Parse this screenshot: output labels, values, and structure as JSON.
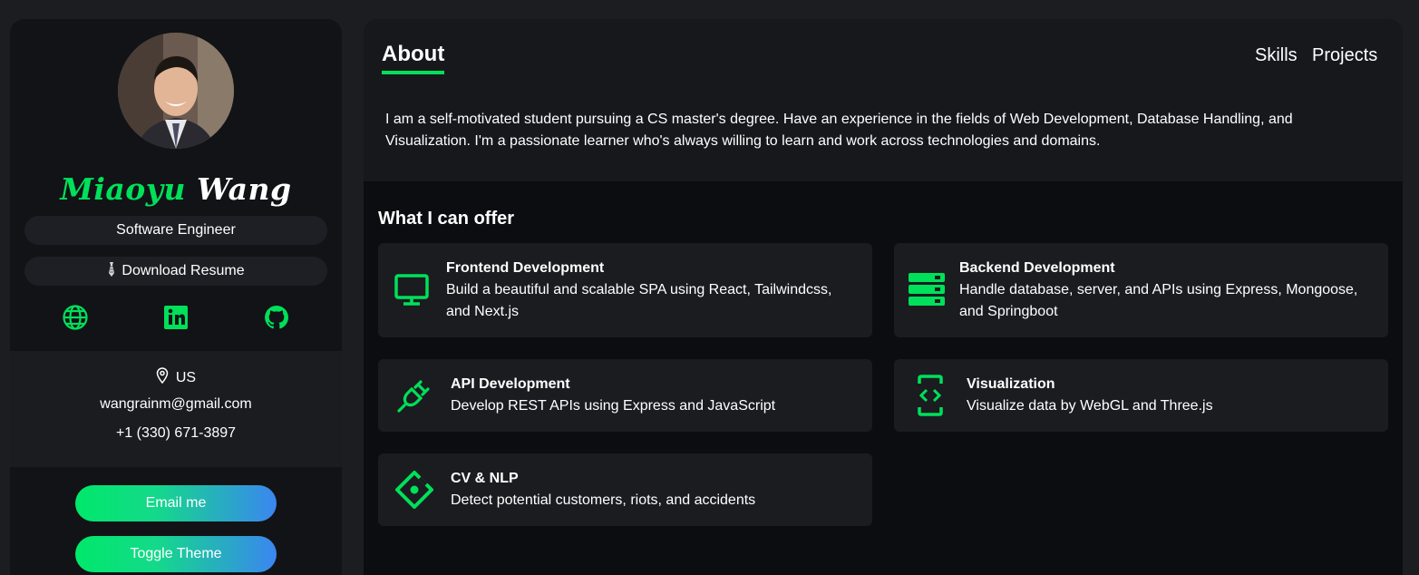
{
  "profile": {
    "first_name": "Miaoyu",
    "last_name": "Wang",
    "title": "Software Engineer",
    "resume_label": "Download Resume",
    "location": "US",
    "email": "wangrainm@gmail.com",
    "phone": "+1 (330) 671-3897",
    "email_button": "Email me",
    "theme_button": "Toggle Theme"
  },
  "socials": [
    "globe-icon",
    "linkedin-icon",
    "github-icon"
  ],
  "nav": {
    "about": "About",
    "skills": "Skills",
    "projects": "Projects"
  },
  "about": {
    "text": "I am a self-motivated student pursuing a CS master's degree. Have an experience in the fields of Web Development, Database Handling, and Visualization. I'm a passionate learner who's always willing to learn and work across technologies and domains."
  },
  "offer": {
    "heading": "What I can offer",
    "cards": [
      {
        "title": "Frontend Development",
        "desc": "Build a beautiful and scalable SPA using React, Tailwindcss, and Next.js",
        "icon": "monitor-icon"
      },
      {
        "title": "Backend Development",
        "desc": "Handle database, server, and APIs using Express, Mongoose, and Springboot",
        "icon": "server-icon"
      },
      {
        "title": "API Development",
        "desc": "Develop REST APIs using Express and JavaScript",
        "icon": "plug-icon"
      },
      {
        "title": "Visualization",
        "desc": "Visualize data by WebGL and Three.js",
        "icon": "code-device-icon"
      },
      {
        "title": "CV & NLP",
        "desc": "Detect potential customers, riots, and accidents",
        "icon": "target-diamond-icon"
      }
    ]
  },
  "colors": {
    "accent": "#00e05a",
    "background": "#1c1d21",
    "panel": "#121316",
    "card": "#1b1c20",
    "gradient_end": "#3a86f0"
  }
}
